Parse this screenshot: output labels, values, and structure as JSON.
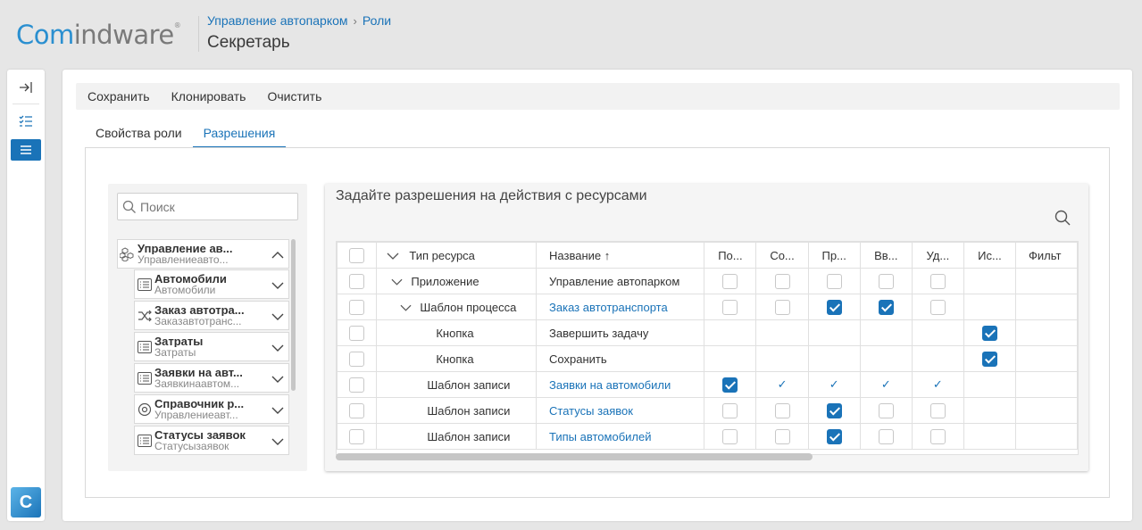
{
  "app": {
    "logo_part1": "Com",
    "logo_part2": "indware",
    "logo_mark": "®"
  },
  "breadcrumb": [
    "Управление автопарком",
    "Роли"
  ],
  "page_title": "Секретарь",
  "toolbar": {
    "save": "Сохранить",
    "clone": "Клонировать",
    "clear": "Очистить"
  },
  "tabs": [
    "Свойства роли",
    "Разрешения"
  ],
  "tree": {
    "search_placeholder": "Поиск",
    "items": [
      {
        "title": "Управление ав...",
        "subtitle": "Управлениеавто...",
        "icon": "cubes-icon",
        "expanded": true
      },
      {
        "title": "Автомобили",
        "subtitle": "Автомобили",
        "icon": "list-icon"
      },
      {
        "title": "Заказ автотра...",
        "subtitle": "Заказавтотранс...",
        "icon": "shuffle-icon"
      },
      {
        "title": "Затраты",
        "subtitle": "Затраты",
        "icon": "list-icon"
      },
      {
        "title": "Заявки на авт...",
        "subtitle": "Заявкинаавтом...",
        "icon": "list-icon"
      },
      {
        "title": "Справочник р...",
        "subtitle": "Управлениеавт...",
        "icon": "circle-icon"
      },
      {
        "title": "Статусы заявок",
        "subtitle": "Статусызаявок",
        "icon": "list-icon"
      }
    ]
  },
  "permissions": {
    "title": "Задайте разрешения на действия с ресурсами",
    "columns": {
      "type": "Тип ресурса",
      "name": "Название ↑",
      "c1": "По...",
      "c2": "Со...",
      "c3": "Пр...",
      "c4": "Вв...",
      "c5": "Уд...",
      "c6": "Ис...",
      "c7": "Фильт"
    },
    "rows": [
      {
        "type": "Приложение",
        "name": "Управление автопарком",
        "link": false,
        "indent": 0,
        "expander": true,
        "cells": [
          "box",
          "box",
          "box",
          "box",
          "box",
          "",
          ""
        ]
      },
      {
        "type": "Шаблон процесса",
        "name": "Заказ автотранспорта",
        "link": true,
        "indent": 1,
        "expander": true,
        "cells": [
          "box",
          "box",
          "on",
          "on",
          "box",
          "",
          ""
        ]
      },
      {
        "type": "Кнопка",
        "name": "Завершить задачу",
        "link": false,
        "indent": 2,
        "expander": false,
        "cells": [
          "",
          "",
          "",
          "",
          "",
          "on",
          ""
        ]
      },
      {
        "type": "Кнопка",
        "name": "Сохранить",
        "link": false,
        "indent": 2,
        "expander": false,
        "cells": [
          "",
          "",
          "",
          "",
          "",
          "on",
          ""
        ]
      },
      {
        "type": "Шаблон записи",
        "name": "Заявки на автомобили",
        "link": true,
        "indent": 1,
        "expander": false,
        "cells": [
          "on",
          "tick",
          "tick",
          "tick",
          "tick",
          "",
          ""
        ]
      },
      {
        "type": "Шаблон записи",
        "name": "Статусы заявок",
        "link": true,
        "indent": 1,
        "expander": false,
        "cells": [
          "box",
          "box",
          "on",
          "box",
          "box",
          "",
          ""
        ]
      },
      {
        "type": "Шаблон записи",
        "name": "Типы автомобилей",
        "link": true,
        "indent": 1,
        "expander": false,
        "cells": [
          "box",
          "box",
          "on",
          "box",
          "box",
          "",
          ""
        ]
      }
    ]
  },
  "colors": {
    "accent": "#1a73b8",
    "logo_blue": "#2a8fd0"
  }
}
